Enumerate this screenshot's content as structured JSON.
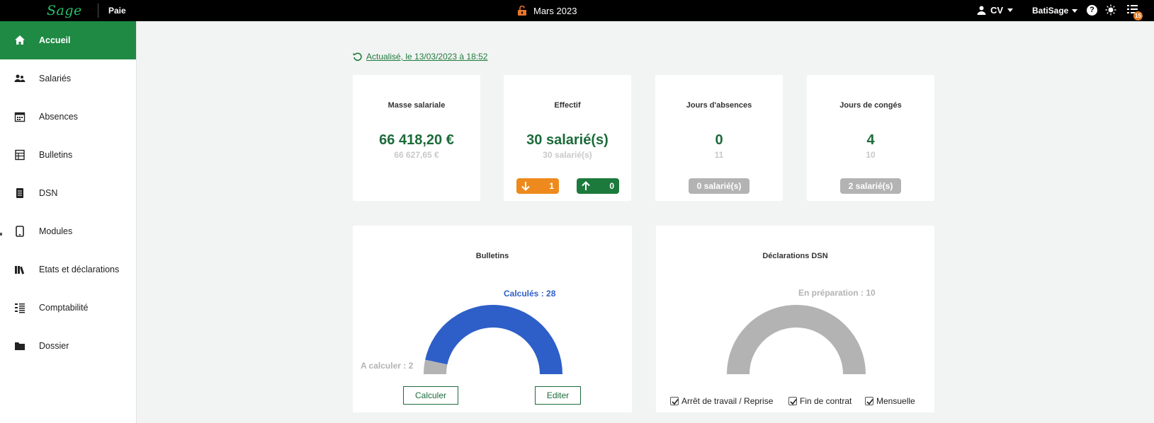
{
  "topbar": {
    "logo": "Sage",
    "app_name": "Paie",
    "period": "Mars 2023",
    "user": "CV",
    "company": "BatiSage",
    "help": "?",
    "notif_count": "15",
    "accent_color": "#29c26a"
  },
  "sidebar": {
    "items": [
      {
        "label": "Accueil",
        "icon": "home-icon",
        "active": true
      },
      {
        "label": "Salariés",
        "icon": "users-icon"
      },
      {
        "label": "Absences",
        "icon": "calendar-icon"
      },
      {
        "label": "Bulletins",
        "icon": "table-icon"
      },
      {
        "label": "DSN",
        "icon": "document-icon"
      },
      {
        "label": "Modules",
        "icon": "tablet-icon"
      },
      {
        "label": "Etats et déclarations",
        "icon": "books-icon"
      },
      {
        "label": "Comptabilité",
        "icon": "list-icon"
      },
      {
        "label": "Dossier",
        "icon": "folder-icon"
      }
    ],
    "active_color": "#1f8a44"
  },
  "main": {
    "refresh_link": "Actualisé, le 13/03/2023 à 18:52",
    "kpis": {
      "masse": {
        "title": "Masse salariale",
        "value": "66 418,20 €",
        "previous": "66 627,65 €"
      },
      "effectif": {
        "title": "Effectif",
        "value": "30 salarié(s)",
        "previous": "30 salarié(s)",
        "out_count": "1",
        "in_count": "0"
      },
      "absences": {
        "title": "Jours d'absences",
        "value": "0",
        "previous": "11",
        "badge": "0 salarié(s)"
      },
      "conges": {
        "title": "Jours de congés",
        "value": "4",
        "previous": "10",
        "badge": "2 salarié(s)"
      }
    },
    "bulletins": {
      "title": "Bulletins",
      "calculated_label": "Calculés : 28",
      "to_calculate_label": "A calculer : 2",
      "calculated": 28,
      "to_calculate": 2,
      "calculate_button": "Calculer",
      "edit_button": "Editer",
      "calculated_color": "#2e5fc8",
      "pending_color": "#b3b3b3"
    },
    "dsn": {
      "title": "Déclarations DSN",
      "preparation_label": "En préparation : 10",
      "in_preparation": 10,
      "filters": [
        {
          "label": "Arrêt de travail / Reprise",
          "checked": true
        },
        {
          "label": "Fin de contrat",
          "checked": true
        },
        {
          "label": "Mensuelle",
          "checked": true
        }
      ]
    }
  }
}
